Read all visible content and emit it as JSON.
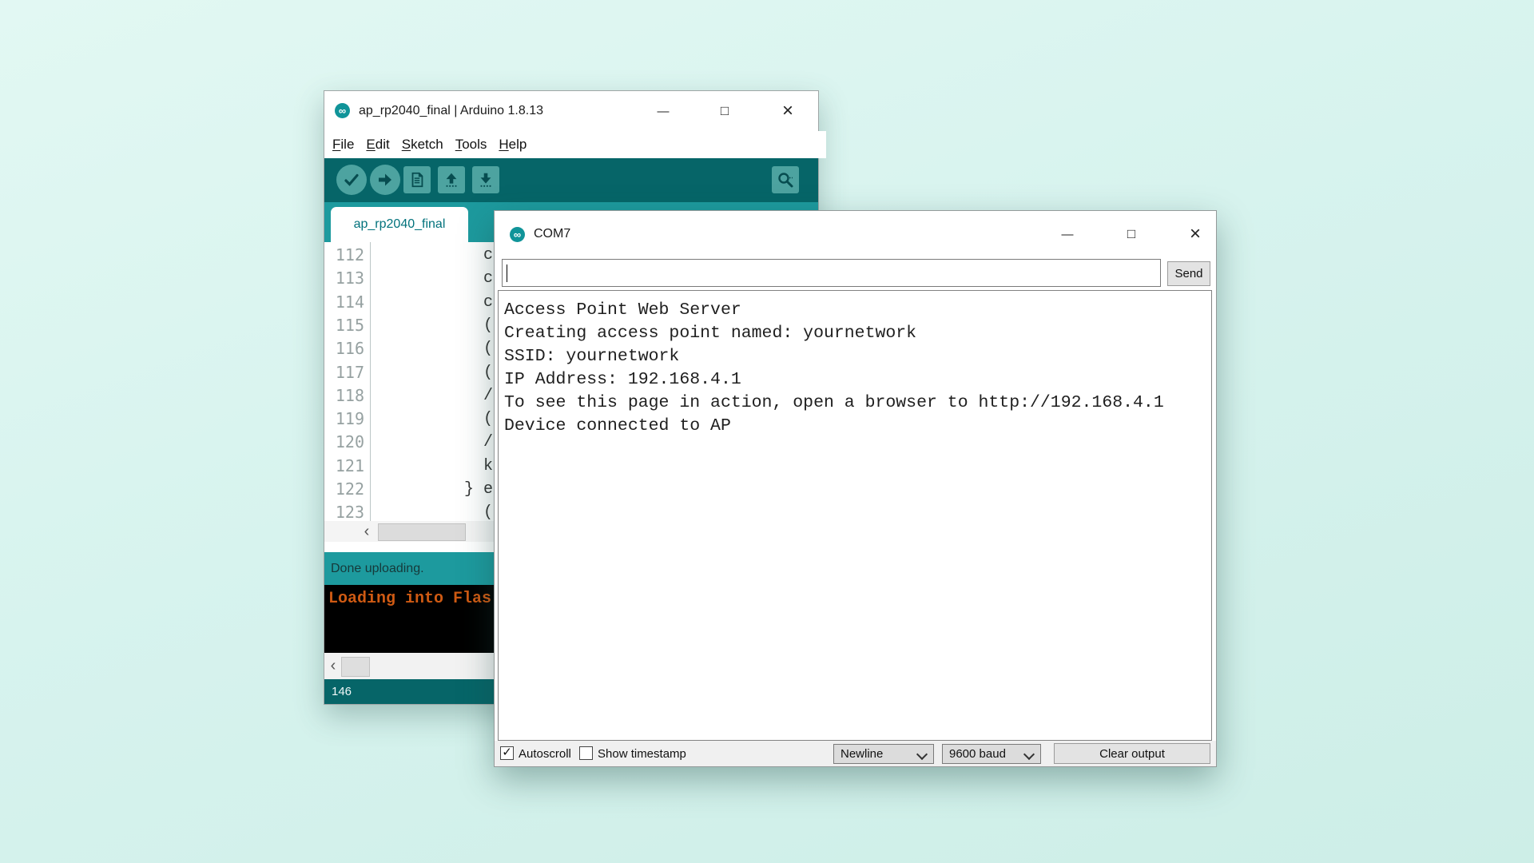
{
  "theme": {
    "background": "#d7f3ee",
    "teal_dark": "#066568",
    "teal_mid": "#1d9a9e",
    "teal_button": "#4da3a0",
    "console_text_color": "#cf5a13"
  },
  "icons": {
    "minimize": "—",
    "maximize": "□",
    "close": "×",
    "infinity": "∞",
    "check": "✓",
    "scroll_left": "‹"
  },
  "arduino_window": {
    "title": "ap_rp2040_final | Arduino 1.8.13",
    "menu_items": [
      "File",
      "Edit",
      "Sketch",
      "Tools",
      "Help"
    ],
    "toolbar_buttons": [
      "verify",
      "upload",
      "new",
      "open",
      "save",
      "serial-monitor"
    ],
    "tab_label": "ap_rp2040_final",
    "editor_lines": [
      {
        "number": "112",
        "code": "c"
      },
      {
        "number": "113",
        "code": "c"
      },
      {
        "number": "114",
        "code": "c"
      },
      {
        "number": "115",
        "code": "("
      },
      {
        "number": "116",
        "code": "("
      },
      {
        "number": "117",
        "code": "("
      },
      {
        "number": "118",
        "code": "/"
      },
      {
        "number": "119",
        "code": "("
      },
      {
        "number": "120",
        "code": "/"
      },
      {
        "number": "121",
        "code": "k"
      },
      {
        "number": "122",
        "code": "} e"
      },
      {
        "number": "123",
        "code": "("
      }
    ],
    "status_text": "Done uploading.",
    "console_text": "Loading into Flas",
    "footer_line": "146"
  },
  "com7_window": {
    "title": "COM7",
    "input_value": "",
    "send_button": "Send",
    "output_lines": [
      "Access Point Web Server",
      "Creating access point named: yournetwork",
      "SSID: yournetwork",
      "IP Address: 192.168.4.1",
      "To see this page in action, open a browser to http://192.168.4.1",
      "Device connected to AP"
    ],
    "controls": {
      "autoscroll": {
        "label": "Autoscroll",
        "checked": true
      },
      "show_timestamp": {
        "label": "Show timestamp",
        "checked": false
      },
      "line_ending": {
        "value": "Newline"
      },
      "baud_rate": {
        "value": "9600 baud"
      },
      "clear_button": "Clear output"
    }
  }
}
